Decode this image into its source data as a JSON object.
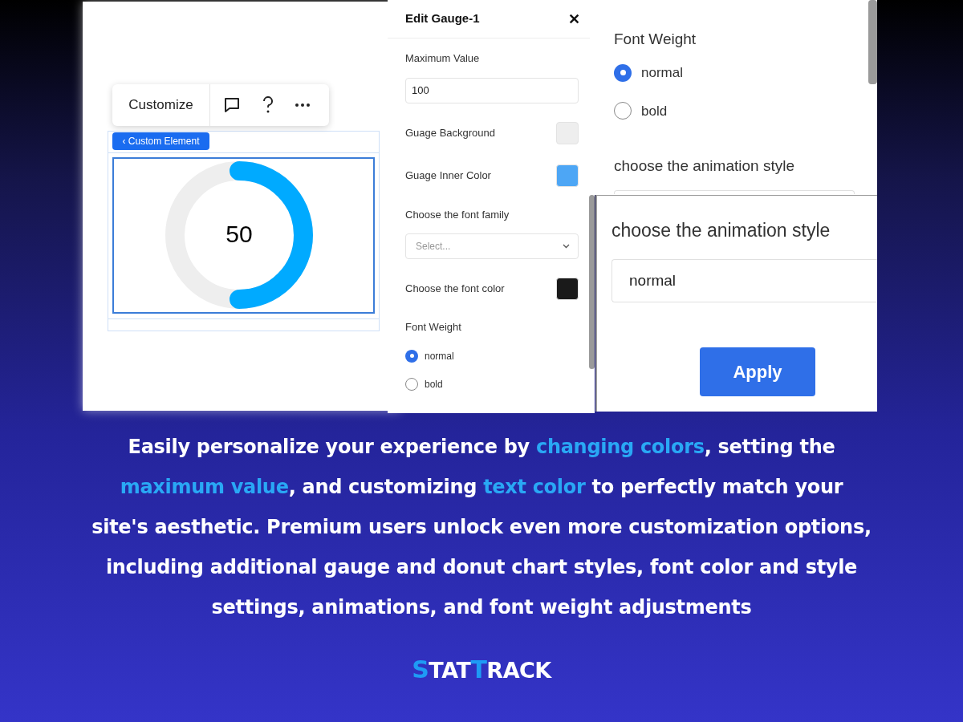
{
  "editor_canvas": {
    "toolbar": {
      "label": "Customize"
    },
    "element_tag": "‹ Custom Element",
    "gauge": {
      "value": "50",
      "level": 0.5
    }
  },
  "edit_panel": {
    "title": "Edit Gauge-1",
    "close": "✕",
    "fields": [
      {
        "kind": "input",
        "label": "Maximum Value",
        "value": "100"
      },
      {
        "kind": "swatch",
        "label": "Guage Background",
        "color": "#eeeeee"
      },
      {
        "kind": "swatch",
        "label": "Guage Inner Color",
        "color": "#4da6f5"
      },
      {
        "kind": "select",
        "label": "Choose the font family",
        "placeholder": "Select..."
      },
      {
        "kind": "swatch",
        "label": "Choose the font color",
        "color": "#1a1a1a"
      },
      {
        "kind": "radio",
        "label": "Font Weight",
        "options": [
          {
            "label": "normal",
            "selected": true
          },
          {
            "label": "bold",
            "selected": false
          }
        ]
      }
    ]
  },
  "weight_panel": {
    "label": "Font Weight",
    "options": [
      {
        "label": "normal",
        "selected": true
      },
      {
        "label": "bold",
        "selected": false
      }
    ],
    "animation_label": "choose the animation style"
  },
  "animation_panel": {
    "label": "choose the animation style",
    "value": "normal",
    "apply": "Apply"
  },
  "caption": {
    "lines": [
      [
        {
          "text": "Easily personalize your experience by ",
          "highlight": false
        },
        {
          "text": "changing colors",
          "highlight": true
        },
        {
          "text": ", setting the",
          "highlight": false
        }
      ],
      [
        {
          "text": "maximum value",
          "highlight": true
        },
        {
          "text": ", and customizing ",
          "highlight": false
        },
        {
          "text": "text color",
          "highlight": true
        },
        {
          "text": " to perfectly match your",
          "highlight": false
        }
      ],
      [
        {
          "text": "site's aesthetic. Premium users unlock even more customization options,",
          "highlight": false
        }
      ],
      [
        {
          "text": "including additional gauge and donut chart styles, font color and style",
          "highlight": false
        }
      ],
      [
        {
          "text": "settings, animations, and font weight adjustments",
          "highlight": false
        }
      ]
    ]
  },
  "logo": [
    {
      "text": "S",
      "accent": true
    },
    {
      "text": "TAT",
      "accent": false
    },
    {
      "text": "T",
      "accent": true
    },
    {
      "text": "RACK",
      "accent": false
    }
  ]
}
